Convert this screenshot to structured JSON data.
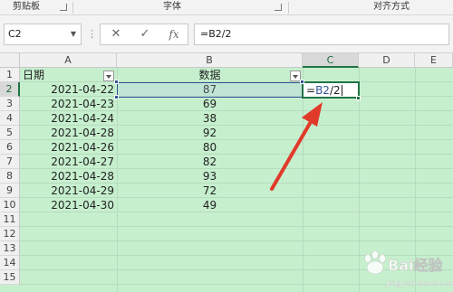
{
  "ribbon": {
    "groups": [
      {
        "label": "剪贴板"
      },
      {
        "label": "字体"
      },
      {
        "label": "对齐方式"
      }
    ]
  },
  "formula_bar": {
    "name_box": "C2",
    "cancel_icon": "close-icon",
    "enter_icon": "check-icon",
    "fx_label": "fx",
    "formula": "=B2/2"
  },
  "sheet": {
    "columns": [
      "A",
      "B",
      "C",
      "D",
      "E"
    ],
    "rows": [
      "1",
      "2",
      "3",
      "4",
      "5",
      "6",
      "7",
      "8",
      "9",
      "10",
      "11",
      "12",
      "13",
      "14",
      "15"
    ],
    "header_a": "日期",
    "header_b": "数据",
    "dates": [
      "2021-04-22",
      "2021-04-23",
      "2021-04-24",
      "2021-04-28",
      "2021-04-26",
      "2021-04-27",
      "2021-04-28",
      "2021-04-29",
      "2021-04-30"
    ],
    "values": [
      "87",
      "69",
      "38",
      "92",
      "80",
      "82",
      "93",
      "72",
      "49"
    ],
    "active_cell": "C2",
    "editing_prefix": "=",
    "editing_ref": "B2",
    "editing_suffix": "/2",
    "fill_color": "#c6efce",
    "accent_color": "#217346",
    "arrow_color": "#e03a2a"
  },
  "watermark": {
    "text": "Bai经验",
    "sub": "jingyan.baidu.com"
  }
}
